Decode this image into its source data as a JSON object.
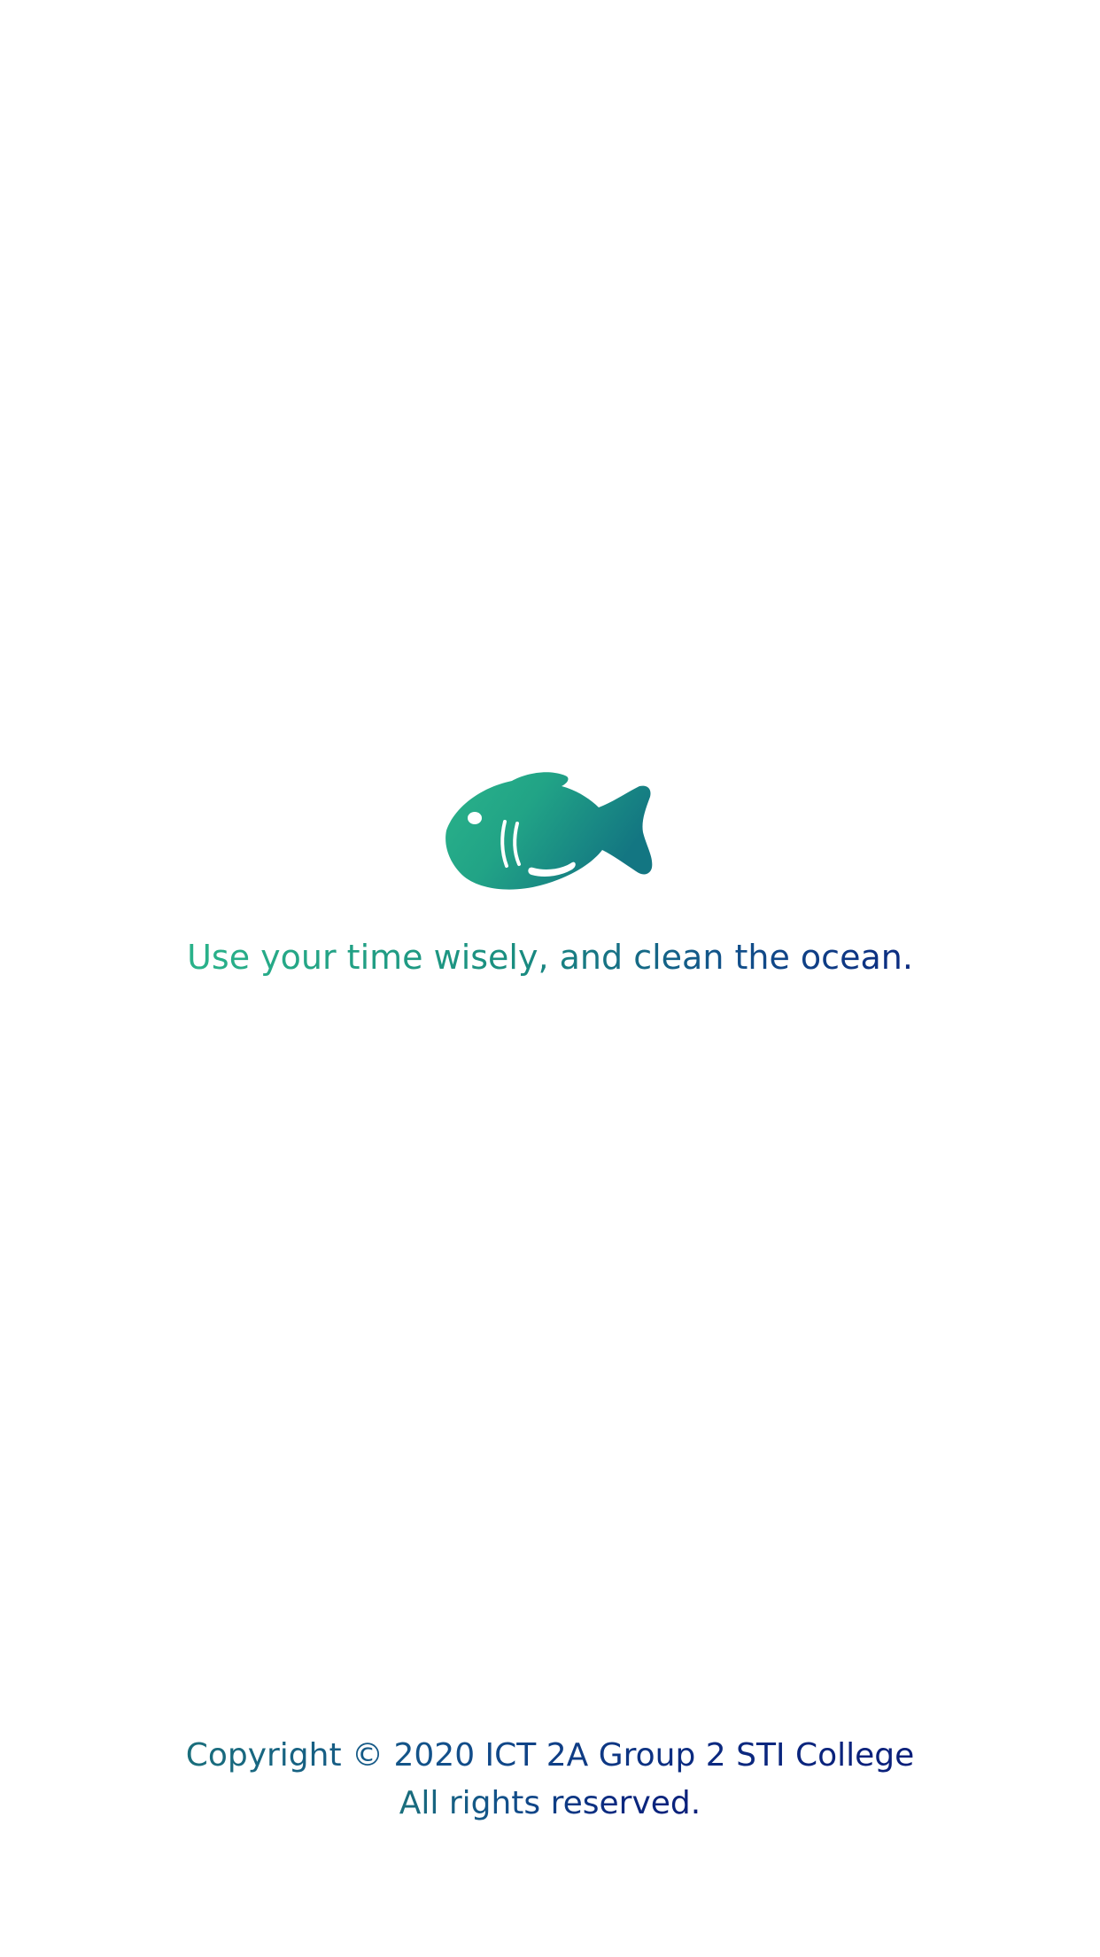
{
  "splash": {
    "logo_icon": "fish-icon",
    "tagline": "Use your time wisely, and clean the ocean."
  },
  "footer": {
    "copyright": "Copyright © 2020 ICT 2A Group 2 STI College",
    "rights": "All rights reserved."
  },
  "colors": {
    "gradient_start": "#2ab38a",
    "gradient_mid": "#1a8e80",
    "gradient_end": "#0b2a80",
    "background": "#ffffff"
  }
}
